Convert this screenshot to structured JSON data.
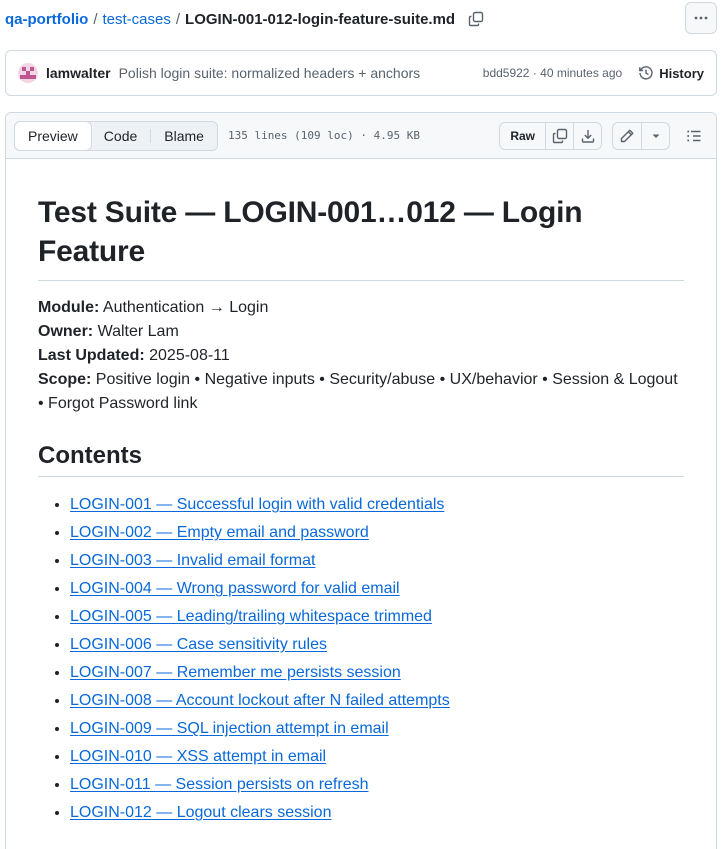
{
  "breadcrumb": {
    "repo": "qa-portfolio",
    "folder": "test-cases",
    "file": "LOGIN-001-012-login-feature-suite.md",
    "separator": "/"
  },
  "commit": {
    "author": "lamwalter",
    "message": "Polish login suite: normalized headers + anchors",
    "meta": "bdd5922 · 40 minutes ago",
    "history_label": "History"
  },
  "toolbar": {
    "tabs": [
      "Preview",
      "Code",
      "Blame"
    ],
    "active_tab": "Preview",
    "file_info": "135 lines (109 loc) · 4.95 KB",
    "raw_label": "Raw"
  },
  "doc": {
    "title": "Test Suite — LOGIN-001…012 — Login Feature",
    "meta": [
      {
        "label": "Module:",
        "value": "Authentication → Login"
      },
      {
        "label": "Owner:",
        "value": "Walter Lam"
      },
      {
        "label": "Last Updated:",
        "value": "2025-08-11"
      },
      {
        "label": "Scope:",
        "value": "Positive login • Negative inputs • Security/abuse • UX/behavior • Session & Logout • Forgot Password link"
      }
    ],
    "contents_heading": "Contents",
    "contents": [
      "LOGIN-001 — Successful login with valid credentials",
      "LOGIN-002 — Empty email and password",
      "LOGIN-003 — Invalid email format",
      "LOGIN-004 — Wrong password for valid email",
      "LOGIN-005 — Leading/trailing whitespace trimmed",
      "LOGIN-006 — Case sensitivity rules",
      "LOGIN-007 — Remember me persists session",
      "LOGIN-008 — Account lockout after N failed attempts",
      "LOGIN-009 — SQL injection attempt in email",
      "LOGIN-010 — XSS attempt in email",
      "LOGIN-011 — Session persists on refresh",
      "LOGIN-012 — Logout clears session"
    ]
  },
  "colors": {
    "link": "#0969da",
    "muted": "#59636e",
    "border": "#d1d9e0",
    "avatar": "#c0568f"
  },
  "icons": [
    "copy-icon",
    "kebab-icon",
    "history-icon",
    "download-icon",
    "pencil-icon",
    "chevron-down-icon",
    "list-outline-icon"
  ]
}
